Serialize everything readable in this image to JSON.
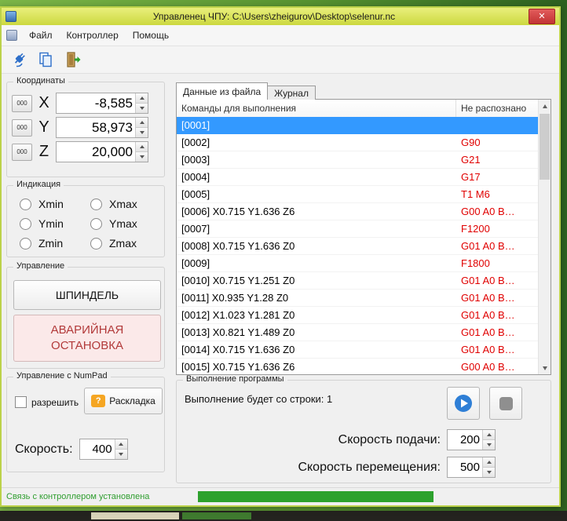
{
  "window": {
    "title": "Управленец ЧПУ: C:\\Users\\zheigurov\\Desktop\\selenur.nc",
    "close_glyph": "✕"
  },
  "menu": {
    "items": [
      {
        "label": "Файл"
      },
      {
        "label": "Контроллер"
      },
      {
        "label": "Помощь"
      }
    ]
  },
  "coordinates": {
    "group_label": "Координаты",
    "zero_label": "000",
    "axes": [
      {
        "label": "X",
        "value": "-8,585"
      },
      {
        "label": "Y",
        "value": "58,973"
      },
      {
        "label": "Z",
        "value": "20,000"
      }
    ]
  },
  "indication": {
    "group_label": "Индикация",
    "options": [
      {
        "label": "Xmin"
      },
      {
        "label": "Xmax"
      },
      {
        "label": "Ymin"
      },
      {
        "label": "Ymax"
      },
      {
        "label": "Zmin"
      },
      {
        "label": "Zmax"
      }
    ]
  },
  "control": {
    "group_label": "Управление",
    "spindle_label": "ШПИНДЕЛЬ",
    "estop_label": "АВАРИЙНАЯ ОСТАНОВКА"
  },
  "numpad": {
    "group_label": "Управление с NumPad",
    "enable_label": "разрешить",
    "layout_label": "Раскладка",
    "question_glyph": "?",
    "speed_label": "Скорость:",
    "speed_value": "400"
  },
  "tabs": [
    {
      "label": "Данные из файла"
    },
    {
      "label": "Журнал"
    }
  ],
  "table": {
    "headers": [
      {
        "label": "Команды для выполнения"
      },
      {
        "label": "Не распознано"
      }
    ],
    "rows": [
      {
        "cmd": "[0001]",
        "err": "",
        "selected": true
      },
      {
        "cmd": "[0002]",
        "err": "G90"
      },
      {
        "cmd": "[0003]",
        "err": "G21"
      },
      {
        "cmd": "[0004]",
        "err": "G17"
      },
      {
        "cmd": "[0005]",
        "err": "T1 M6"
      },
      {
        "cmd": "[0006] X0.715  Y1.636  Z6",
        "err": "G00 A0 B…"
      },
      {
        "cmd": "[0007]",
        "err": "F1200"
      },
      {
        "cmd": "[0008] X0.715  Y1.636  Z0",
        "err": "G01 A0 B…"
      },
      {
        "cmd": "[0009]",
        "err": "F1800"
      },
      {
        "cmd": "[0010] X0.715  Y1.251  Z0",
        "err": "G01 A0 B…"
      },
      {
        "cmd": "[0011] X0.935  Y1.28  Z0",
        "err": "G01 A0 B…"
      },
      {
        "cmd": "[0012] X1.023  Y1.281  Z0",
        "err": "G01 A0 B…"
      },
      {
        "cmd": "[0013] X0.821  Y1.489  Z0",
        "err": "G01 A0 B…"
      },
      {
        "cmd": "[0014] X0.715  Y1.636  Z0",
        "err": "G01 A0 B…"
      },
      {
        "cmd": "[0015] X0.715  Y1.636  Z6",
        "err": "G00 A0 B…"
      }
    ]
  },
  "execution": {
    "group_label": "Выполнение программы",
    "start_line_text": "Выполнение будет со строки: 1",
    "feed_label": "Скорость подачи:",
    "feed_value": "200",
    "move_label": "Скорость перемещения:",
    "move_value": "500"
  },
  "status": {
    "text": "Связь с контроллером установлена"
  }
}
